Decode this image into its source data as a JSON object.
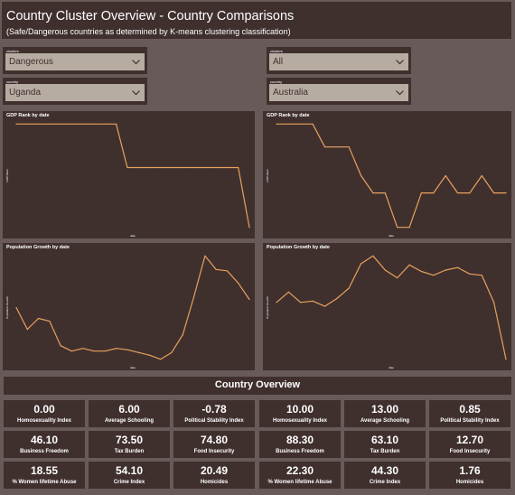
{
  "header": {
    "title": "Country Cluster Overview - Country Comparisons",
    "subtitle": "(Safe/Dangerous countries as determined by K-means clustering classification)"
  },
  "slicers": {
    "left_cluster": {
      "label": "clusters",
      "value": "Dangerous"
    },
    "right_cluster": {
      "label": "clusters",
      "value": "All"
    },
    "left_country": {
      "label": "country",
      "value": "Uganda"
    },
    "right_country": {
      "label": "country",
      "value": "Australia"
    }
  },
  "charts": {
    "gdp_left_title": "GDP Rank by date",
    "gdp_right_title": "GDP Rank by date",
    "pop_left_title": "Population Growth by date",
    "pop_right_title": "Population Growth by date",
    "gdp_ylabel": "GDP Rank",
    "pop_ylabel": "Population Growth",
    "xlabel": "date"
  },
  "chart_data": [
    {
      "type": "line",
      "title": "GDP Rank by date",
      "ylabel": "GDP Rank",
      "xlabel": "date",
      "color": "#e7a15c",
      "values": [
        10,
        10,
        10,
        10,
        10,
        10,
        10,
        10,
        10,
        10,
        6,
        6,
        6,
        6,
        6,
        6,
        6,
        6,
        6,
        6,
        6,
        0.5
      ]
    },
    {
      "type": "line",
      "title": "GDP Rank by date",
      "ylabel": "GDP Rank",
      "xlabel": "date",
      "color": "#e7a15c",
      "values": [
        10,
        10,
        10,
        10,
        8,
        8,
        8,
        5.5,
        4,
        4,
        1,
        1,
        4,
        4,
        5.5,
        4,
        4,
        5.5,
        4,
        4
      ]
    },
    {
      "type": "line",
      "title": "Population Growth by date",
      "ylabel": "Population Growth",
      "xlabel": "date",
      "color": "#e7a15c",
      "values": [
        2.0,
        1.2,
        1.6,
        1.5,
        0.6,
        0.4,
        0.5,
        0.4,
        0.4,
        0.5,
        0.45,
        0.35,
        0.25,
        0.1,
        0.35,
        1.0,
        2.4,
        3.9,
        3.4,
        3.35,
        2.9,
        2.3
      ]
    },
    {
      "type": "line",
      "title": "Population Growth by date",
      "ylabel": "Population Growth",
      "xlabel": "date",
      "color": "#e7a15c",
      "values": [
        2.5,
        2.9,
        2.5,
        2.55,
        2.35,
        2.65,
        3.05,
        4.0,
        4.3,
        3.75,
        3.45,
        3.95,
        3.7,
        3.55,
        3.75,
        3.85,
        3.6,
        3.55,
        2.5,
        0.3
      ]
    }
  ],
  "overview": {
    "title": "Country Overview",
    "left": [
      {
        "value": "0.00",
        "label": "Homosexuality Index"
      },
      {
        "value": "6.00",
        "label": "Average Schooling"
      },
      {
        "value": "-0.78",
        "label": "Political Stability Index"
      },
      {
        "value": "46.10",
        "label": "Business Freedom"
      },
      {
        "value": "73.50",
        "label": "Tax Burden"
      },
      {
        "value": "74.80",
        "label": "Food Insecurity"
      },
      {
        "value": "18.55",
        "label": "% Women lifetime Abuse"
      },
      {
        "value": "54.10",
        "label": "Crime Index"
      },
      {
        "value": "20.49",
        "label": "Homicides"
      }
    ],
    "right": [
      {
        "value": "10.00",
        "label": "Homosexuality Index"
      },
      {
        "value": "13.00",
        "label": "Average Schooling"
      },
      {
        "value": "0.85",
        "label": "Political Stability Index"
      },
      {
        "value": "88.30",
        "label": "Business Freedom"
      },
      {
        "value": "63.10",
        "label": "Tax Burden"
      },
      {
        "value": "12.70",
        "label": "Food Insecurity"
      },
      {
        "value": "22.30",
        "label": "% Women lifetime Abuse"
      },
      {
        "value": "44.30",
        "label": "Crime Index"
      },
      {
        "value": "1.76",
        "label": "Homicides"
      }
    ]
  }
}
